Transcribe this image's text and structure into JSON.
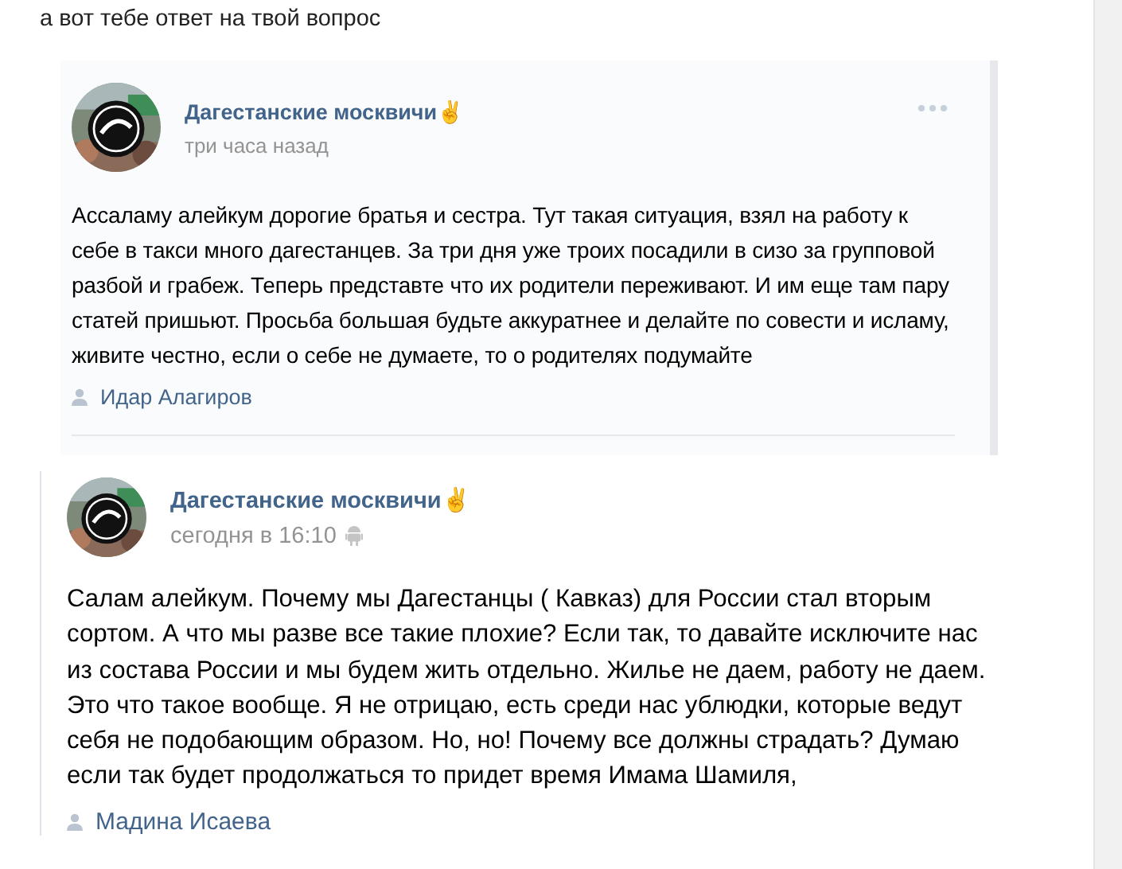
{
  "comment": {
    "text": "а вот тебе ответ на твой вопрос"
  },
  "posts": [
    {
      "kind": "repost",
      "author": "Дагестанские москвичи✌",
      "time": "три часа назад",
      "mobile": false,
      "menu": true,
      "body": "Ассаламу алейкум дорогие братья и сестра. Тут такая ситуация, взял на работу к себе в такси много дагестанцев. За три дня уже троих посадили в сизо за групповой разбой и грабеж. Теперь представте что их родители переживают. И им еще там пару статей пришьют. Просьба большая будьте аккуратнее и делайте по совести и исламу, живите честно, если о себе не думаете, то о родителях подумайте",
      "signer": "Идар Алагиров"
    },
    {
      "kind": "quote",
      "author": "Дагестанские москвичи✌",
      "time": "сегодня в 16:10",
      "mobile": true,
      "menu": false,
      "body": "Салам алейкум. Почему мы Дагестанцы ( Кавказ) для России стал вторым сортом. А что мы разве все такие плохие? Если так, то давайте исключите нас из состава России и мы будем жить отдельно. Жилье не даем, работу не даем. Это что такое вообще. Я не отрицаю, есть среди нас ублюдки, которые ведут себя не подобающим образом. Но, но! Почему все должны страдать? Думаю если так будет продолжаться то придет время Имама Шамиля,",
      "signer": "Мадина Исаева"
    }
  ]
}
